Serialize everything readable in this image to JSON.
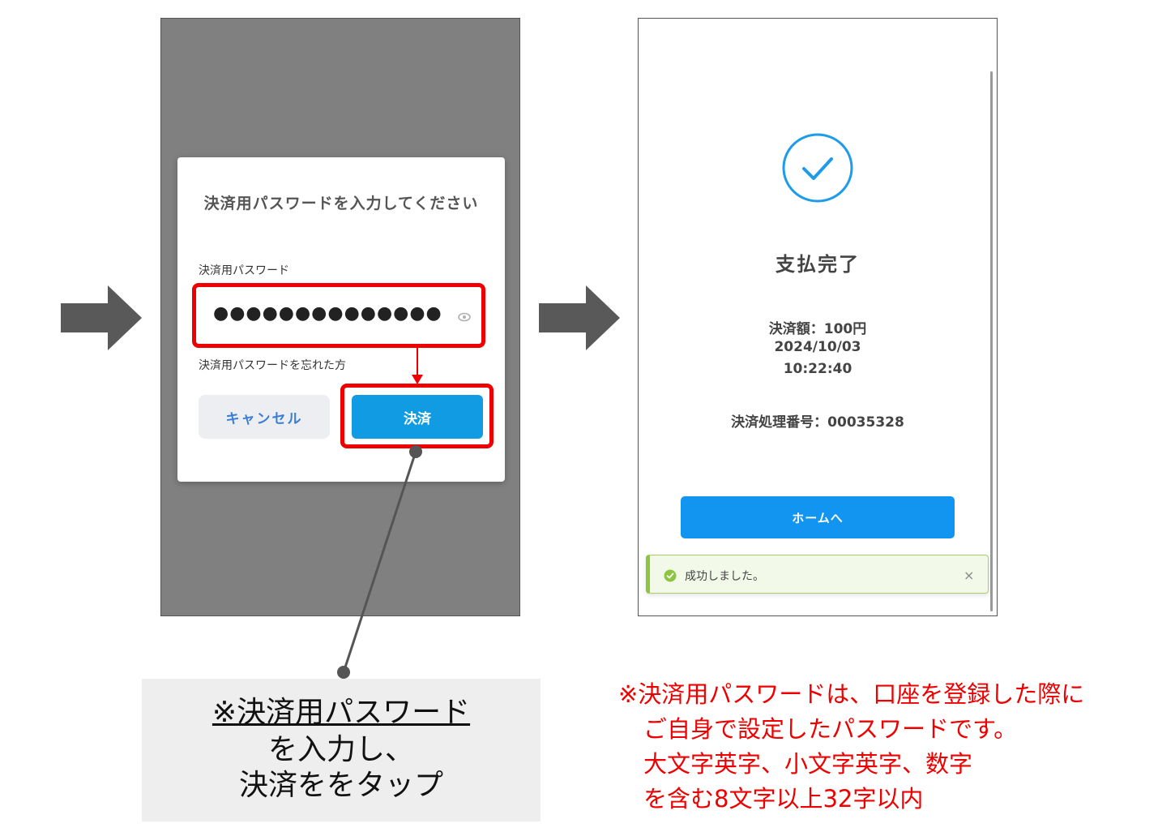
{
  "dialog": {
    "title": "決済用パスワードを入力してください",
    "password_label": "決済用パスワード",
    "password_value": "●●●●●●●●●●●●●●",
    "forgot_link": "決済用パスワードを忘れた方",
    "cancel_label": "キャンセル",
    "pay_label": "決済"
  },
  "callout": {
    "line1": "※決済用パスワード",
    "line2": "を入力し、",
    "line3": "決済ををタップ"
  },
  "result": {
    "title": "支払完了",
    "amount": "決済額：100円",
    "date": "2024/10/03",
    "time": "10:22:40",
    "process_number": "決済処理番号：00035328",
    "home_label": "ホームへ",
    "toast_message": "成功しました。",
    "toast_close": "×"
  },
  "note": {
    "line1": "※決済用パスワードは、口座を登録した際に",
    "line2": "ご自身で設定したパスワードです。",
    "line3": "大文字英字、小文字英字、数字",
    "line4": "を含む8文字以上32字以内"
  },
  "colors": {
    "highlight_red": "#ee0000",
    "pay_button_blue": "#119be2",
    "home_button_blue": "#1295f0",
    "success_green": "#8cc63f",
    "overlay_gray": "#808080"
  }
}
